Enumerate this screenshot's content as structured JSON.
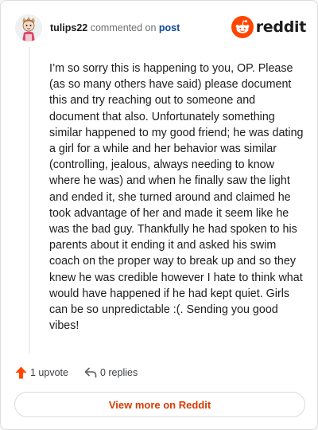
{
  "comment": {
    "username": "tulips22",
    "action_text": "commented on",
    "link_text": "post",
    "body": "I’m so sorry this is happening to you, OP. Please (as so many others have said) please document this and try reaching out to someone and document that also. Unfortunately something similar happened to my good friend; he was dating a girl for a while and her behavior was similar (controlling, jealous, always needing to know where he was) and when he finally saw the light and ended it, she turned around and claimed he took advantage of her and made it seem like he was the bad guy. Thankfully he had spoken to his parents about it ending it and asked his swim coach on the proper way to break up and so they knew he was credible however I hate to think what would have happened if he had kept quiet. Girls can be so unpredictable :(. Sending you good vibes!"
  },
  "brand": {
    "wordmark": "reddit",
    "icon": "reddit-snoo-icon",
    "color": "#ff4500"
  },
  "actions": {
    "upvote_label": "1 upvote",
    "upvote_icon": "upvote-arrow-icon",
    "reply_label": "0 replies",
    "reply_icon": "reply-arrow-icon"
  },
  "footer": {
    "view_button_label": "View more on Reddit",
    "accent": "#d93a00"
  }
}
